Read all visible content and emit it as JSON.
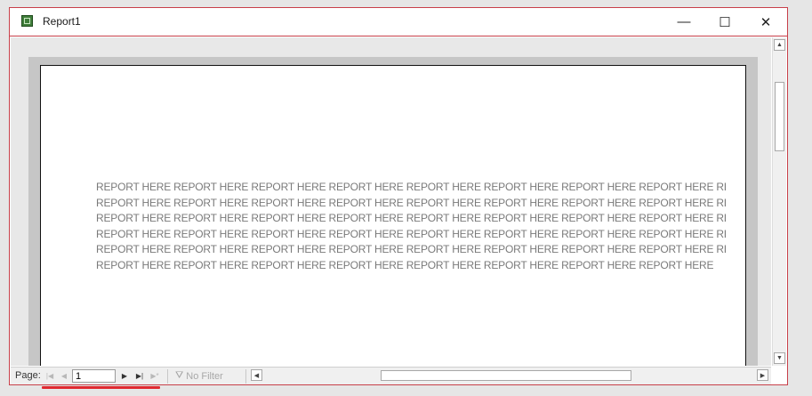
{
  "window": {
    "title": "Report1",
    "icons": {
      "app": "access-report-icon",
      "minimize": "minimize-icon",
      "maximize": "maximize-icon",
      "close": "close-icon"
    },
    "controls": {
      "minimize": "—",
      "maximize": "☐",
      "close": "✕"
    }
  },
  "report": {
    "lines": [
      "REPORT HERE REPORT HERE REPORT HERE REPORT HERE REPORT HERE REPORT HERE REPORT HERE REPORT HERE REPORT HERE REF",
      "REPORT HERE REPORT HERE REPORT HERE REPORT HERE REPORT HERE REPORT HERE REPORT HERE REPORT HERE REPORT HERE REF",
      "REPORT HERE REPORT HERE REPORT HERE REPORT HERE REPORT HERE REPORT HERE REPORT HERE REPORT HERE REPORT HERE REF",
      "REPORT HERE REPORT HERE REPORT HERE REPORT HERE REPORT HERE REPORT HERE REPORT HERE REPORT HERE REPORT HERE REF",
      "REPORT HERE REPORT HERE REPORT HERE REPORT HERE REPORT HERE REPORT HERE REPORT HERE REPORT HERE REPORT HERE REF",
      "REPORT HERE REPORT HERE REPORT HERE REPORT HERE REPORT HERE REPORT HERE REPORT HERE REPORT HERE"
    ]
  },
  "navigation": {
    "page_label": "Page:",
    "page_value": "1",
    "filter_label": "No Filter",
    "icons": {
      "first": "first-record-icon",
      "prev": "previous-record-icon",
      "next": "next-record-icon",
      "last": "last-record-icon",
      "new": "new-record-icon",
      "filter": "filter-icon"
    }
  },
  "colors": {
    "window_border": "#c8404a",
    "highlight_underline": "#e0282f",
    "report_text": "#7a7a7a"
  }
}
